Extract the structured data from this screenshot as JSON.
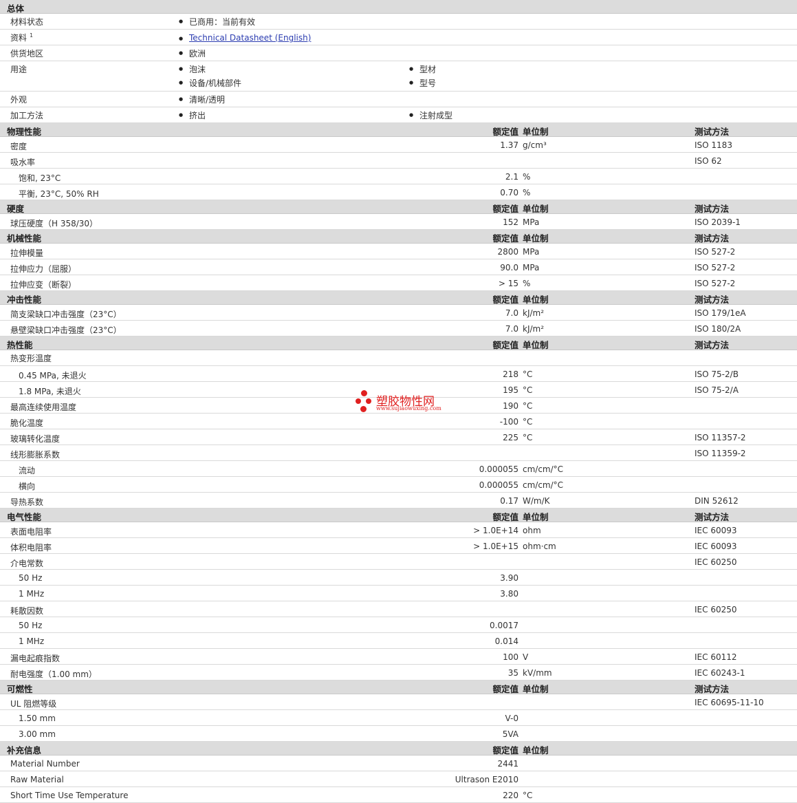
{
  "general": {
    "title": "总体",
    "rows": [
      {
        "label": "材料状态",
        "items": [
          "已商用：当前有效"
        ]
      },
      {
        "label": "资料",
        "sup": "1",
        "link": "Technical Datasheet (English)"
      },
      {
        "label": "供货地区",
        "items": [
          "欧洲"
        ]
      },
      {
        "label": "用途",
        "items": [
          "泡沫",
          "型材",
          "设备/机械部件",
          "型号"
        ]
      },
      {
        "label": "外观",
        "items": [
          "清晰/透明"
        ]
      },
      {
        "label": "加工方法",
        "items": [
          "挤出",
          "注射成型"
        ]
      }
    ]
  },
  "columns": {
    "value": "额定值",
    "unit": "单位制",
    "test": "测试方法"
  },
  "sections": [
    {
      "title": "物理性能",
      "rows": [
        {
          "label": "密度",
          "value": "1.37",
          "unit": "g/cm³",
          "test": "ISO 1183"
        },
        {
          "label": "吸水率",
          "value": "",
          "unit": "",
          "test": "ISO 62"
        },
        {
          "label": "饱和, 23°C",
          "sub": true,
          "value": "2.1",
          "unit": "%",
          "test": ""
        },
        {
          "label": "平衡, 23°C, 50% RH",
          "sub": true,
          "value": "0.70",
          "unit": "%",
          "test": ""
        }
      ]
    },
    {
      "title": "硬度",
      "rows": [
        {
          "label": "球压硬度（H 358/30）",
          "value": "152",
          "unit": "MPa",
          "test": "ISO 2039-1"
        }
      ]
    },
    {
      "title": "机械性能",
      "rows": [
        {
          "label": "拉伸模量",
          "value": "2800",
          "unit": "MPa",
          "test": "ISO 527-2"
        },
        {
          "label": "拉伸应力（屈服）",
          "value": "90.0",
          "unit": "MPa",
          "test": "ISO 527-2"
        },
        {
          "label": "拉伸应变（断裂）",
          "value": "> 15",
          "unit": "%",
          "test": "ISO 527-2"
        }
      ]
    },
    {
      "title": "冲击性能",
      "rows": [
        {
          "label": "简支梁缺口冲击强度（23°C）",
          "value": "7.0",
          "unit": "kJ/m²",
          "test": "ISO 179/1eA"
        },
        {
          "label": "悬壁梁缺口冲击强度（23°C）",
          "value": "7.0",
          "unit": "kJ/m²",
          "test": "ISO 180/2A"
        }
      ]
    },
    {
      "title": "热性能",
      "rows": [
        {
          "label": "热变形温度",
          "value": "",
          "unit": "",
          "test": ""
        },
        {
          "label": "0.45 MPa, 未退火",
          "sub": true,
          "value": "218",
          "unit": "°C",
          "test": "ISO 75-2/B"
        },
        {
          "label": "1.8 MPa, 未退火",
          "sub": true,
          "value": "195",
          "unit": "°C",
          "test": "ISO 75-2/A"
        },
        {
          "label": "最高连续使用温度",
          "value": "190",
          "unit": "°C",
          "test": ""
        },
        {
          "label": "脆化温度",
          "value": "-100",
          "unit": "°C",
          "test": ""
        },
        {
          "label": "玻璃转化温度",
          "value": "225",
          "unit": "°C",
          "test": "ISO 11357-2"
        },
        {
          "label": "线形膨胀系数",
          "value": "",
          "unit": "",
          "test": "ISO 11359-2"
        },
        {
          "label": "流动",
          "sub": true,
          "value": "0.000055",
          "unit": "cm/cm/°C",
          "test": ""
        },
        {
          "label": "横向",
          "sub": true,
          "value": "0.000055",
          "unit": "cm/cm/°C",
          "test": ""
        },
        {
          "label": "导热系数",
          "value": "0.17",
          "unit": "W/m/K",
          "test": "DIN 52612"
        }
      ]
    },
    {
      "title": "电气性能",
      "rows": [
        {
          "label": "表面电阻率",
          "value": "> 1.0E+14",
          "unit": "ohm",
          "test": "IEC 60093"
        },
        {
          "label": "体积电阻率",
          "value": "> 1.0E+15",
          "unit": "ohm·cm",
          "test": "IEC 60093"
        },
        {
          "label": "介电常数",
          "value": "",
          "unit": "",
          "test": "IEC 60250"
        },
        {
          "label": "50 Hz",
          "sub": true,
          "value": "3.90",
          "unit": "",
          "test": ""
        },
        {
          "label": "1 MHz",
          "sub": true,
          "value": "3.80",
          "unit": "",
          "test": ""
        },
        {
          "label": "耗散因数",
          "value": "",
          "unit": "",
          "test": "IEC 60250"
        },
        {
          "label": "50 Hz",
          "sub": true,
          "value": "0.0017",
          "unit": "",
          "test": ""
        },
        {
          "label": "1 MHz",
          "sub": true,
          "value": "0.014",
          "unit": "",
          "test": ""
        },
        {
          "label": "漏电起痕指数",
          "value": "100",
          "unit": "V",
          "test": "IEC 60112"
        },
        {
          "label": "耐电强度（1.00 mm）",
          "value": "35",
          "unit": "kV/mm",
          "test": "IEC 60243-1"
        }
      ]
    },
    {
      "title": "可燃性",
      "rows": [
        {
          "label": "UL 阻燃等级",
          "value": "",
          "unit": "",
          "test": "IEC 60695-11-10"
        },
        {
          "label": "1.50 mm",
          "sub": true,
          "value": "V-0",
          "unit": "",
          "test": ""
        },
        {
          "label": "3.00 mm",
          "sub": true,
          "value": "5VA",
          "unit": "",
          "test": ""
        }
      ]
    },
    {
      "title": "补充信息",
      "noTest": true,
      "rows": [
        {
          "label": "Material Number",
          "value": "2441",
          "unit": "",
          "test": ""
        },
        {
          "label": "Raw Material",
          "value": "Ultrason E2010",
          "unit": "",
          "test": ""
        },
        {
          "label": "Short Time Use Temperature",
          "value": "220",
          "unit": "°C",
          "test": ""
        }
      ]
    }
  ],
  "watermark": {
    "cn": "塑胶物性网",
    "url": "www.sujiaowuxing.com",
    "color": "#e02020"
  }
}
